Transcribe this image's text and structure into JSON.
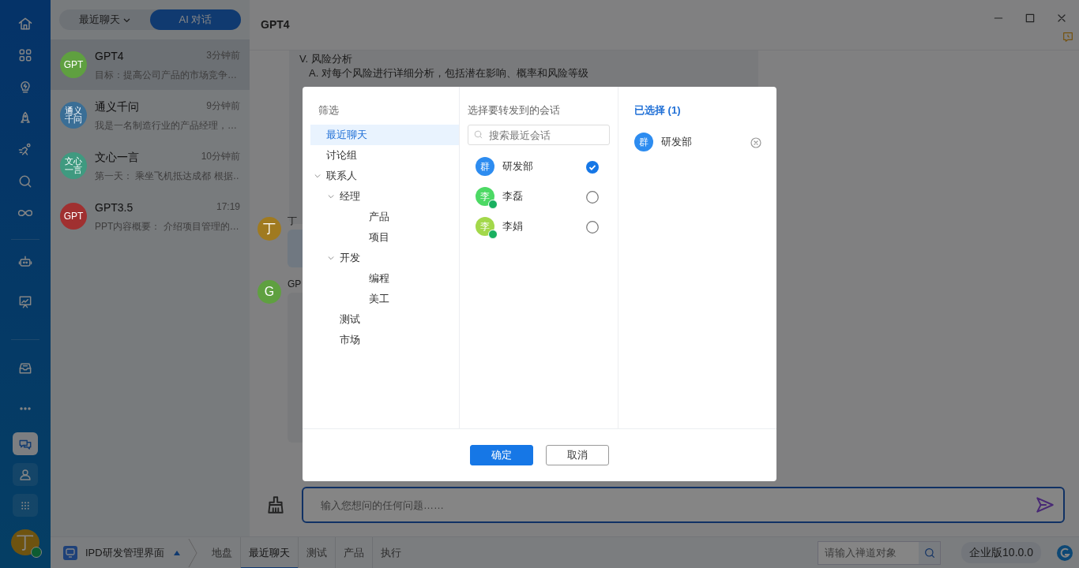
{
  "sidebar": {
    "tools": [
      {
        "selected": true
      },
      {
        "selected": false
      },
      {
        "selected": false
      }
    ],
    "avatar": {
      "text": "丁",
      "online": true
    }
  },
  "chat_list": {
    "tabs": [
      {
        "label": "最近聊天",
        "selected": false,
        "dropdown": true
      },
      {
        "label": "AI 对话",
        "selected": true,
        "dropdown": false
      }
    ],
    "items": [
      {
        "avatar": "GPT",
        "color": "#5fa040",
        "name": "GPT4",
        "time": "3分钟前",
        "preview": "目标：提高公司产品的市场竞争…",
        "selected": true
      },
      {
        "avatar": "通义千问",
        "color": "#3a6e96",
        "name": "通义千问",
        "time": "9分钟前",
        "preview": "我是一名制造行业的产品经理，…",
        "selected": false
      },
      {
        "avatar": "文心一言",
        "color": "#3f9a80",
        "name": "文心一言",
        "time": "10分钟前",
        "preview": "第一天： 乘坐飞机抵达成都 根据…",
        "selected": false
      },
      {
        "avatar": "GPT",
        "color": "#a03030",
        "name": "GPT3.5",
        "time": "17:19",
        "preview": "PPT内容概要： 介绍项目管理的…",
        "selected": false
      }
    ]
  },
  "chat": {
    "title": "GPT4",
    "answer_lines": [
      "V. 风险分析",
      "A. 对每个风险进行详细分析，包括潜在影响、概率和风险等级"
    ],
    "messages": [
      {
        "avatar": "丁",
        "color": "#a07a20",
        "name": "丁",
        "kind": "user"
      },
      {
        "avatar": "G",
        "color": "#5fa040",
        "name": "GP",
        "kind": "ai"
      }
    ],
    "input": {
      "placeholder": "输入您想问的任何问题……"
    }
  },
  "bottom_bar": {
    "app": "IPD研发管理界面",
    "tabs": [
      {
        "label": "地盘",
        "selected": false
      },
      {
        "label": "最近聊天",
        "selected": true
      },
      {
        "label": "测试",
        "selected": false
      },
      {
        "label": "产品",
        "selected": false
      },
      {
        "label": "执行",
        "selected": false
      }
    ],
    "search": {
      "placeholder": "请输入禅道对象"
    },
    "version": "企业版10.0.0"
  },
  "dialog": {
    "filter_title": "筛选",
    "tree": [
      {
        "label": "最近聊天",
        "selected": true
      },
      {
        "label": "讨论组",
        "selected": false
      },
      {
        "label": "联系人",
        "selected": false,
        "expanded": true,
        "children": [
          {
            "label": "经理",
            "selected": false,
            "expanded": true,
            "children": [
              {
                "label": "产品",
                "selected": false
              },
              {
                "label": "项目",
                "selected": false
              }
            ]
          },
          {
            "label": "开发",
            "selected": false,
            "expanded": true,
            "children": [
              {
                "label": "编程",
                "selected": false
              },
              {
                "label": "美工",
                "selected": false
              }
            ]
          },
          {
            "label": "测试",
            "selected": false
          },
          {
            "label": "市场",
            "selected": false
          }
        ]
      }
    ],
    "list_title": "选择要转发到的会话",
    "search": {
      "placeholder": "搜索最近会话"
    },
    "conversations": [
      {
        "avatar": "群",
        "color": "#2d8cf0",
        "name": "研发部",
        "online": false,
        "checked": true
      },
      {
        "avatar": "李",
        "color": "#4cd964",
        "name": "李磊",
        "online": true,
        "checked": false
      },
      {
        "avatar": "李",
        "color": "#a3d84a",
        "name": "李娟",
        "online": true,
        "checked": false
      }
    ],
    "selected_title": "已选择 (1)",
    "selected_items": [
      {
        "avatar": "群",
        "color": "#2d8cf0",
        "name": "研发部"
      }
    ],
    "buttons": [
      {
        "label": "确定",
        "kind": "primary"
      },
      {
        "label": "取消",
        "kind": "secondary"
      }
    ]
  }
}
